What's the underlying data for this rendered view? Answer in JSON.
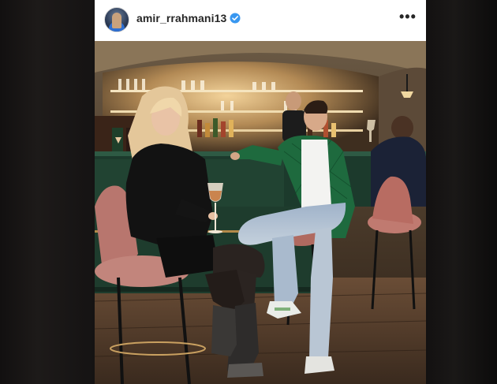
{
  "post": {
    "username": "amir_rrahmani13",
    "verified": true,
    "more_label": "•••",
    "avatar": "user-avatar",
    "photo": "post-photo"
  },
  "colors": {
    "verified_badge": "#3897f0",
    "header_bg": "#ffffff",
    "text": "#262626"
  },
  "icons": {
    "verified": "verified-badge-icon",
    "more": "more-options-icon"
  }
}
